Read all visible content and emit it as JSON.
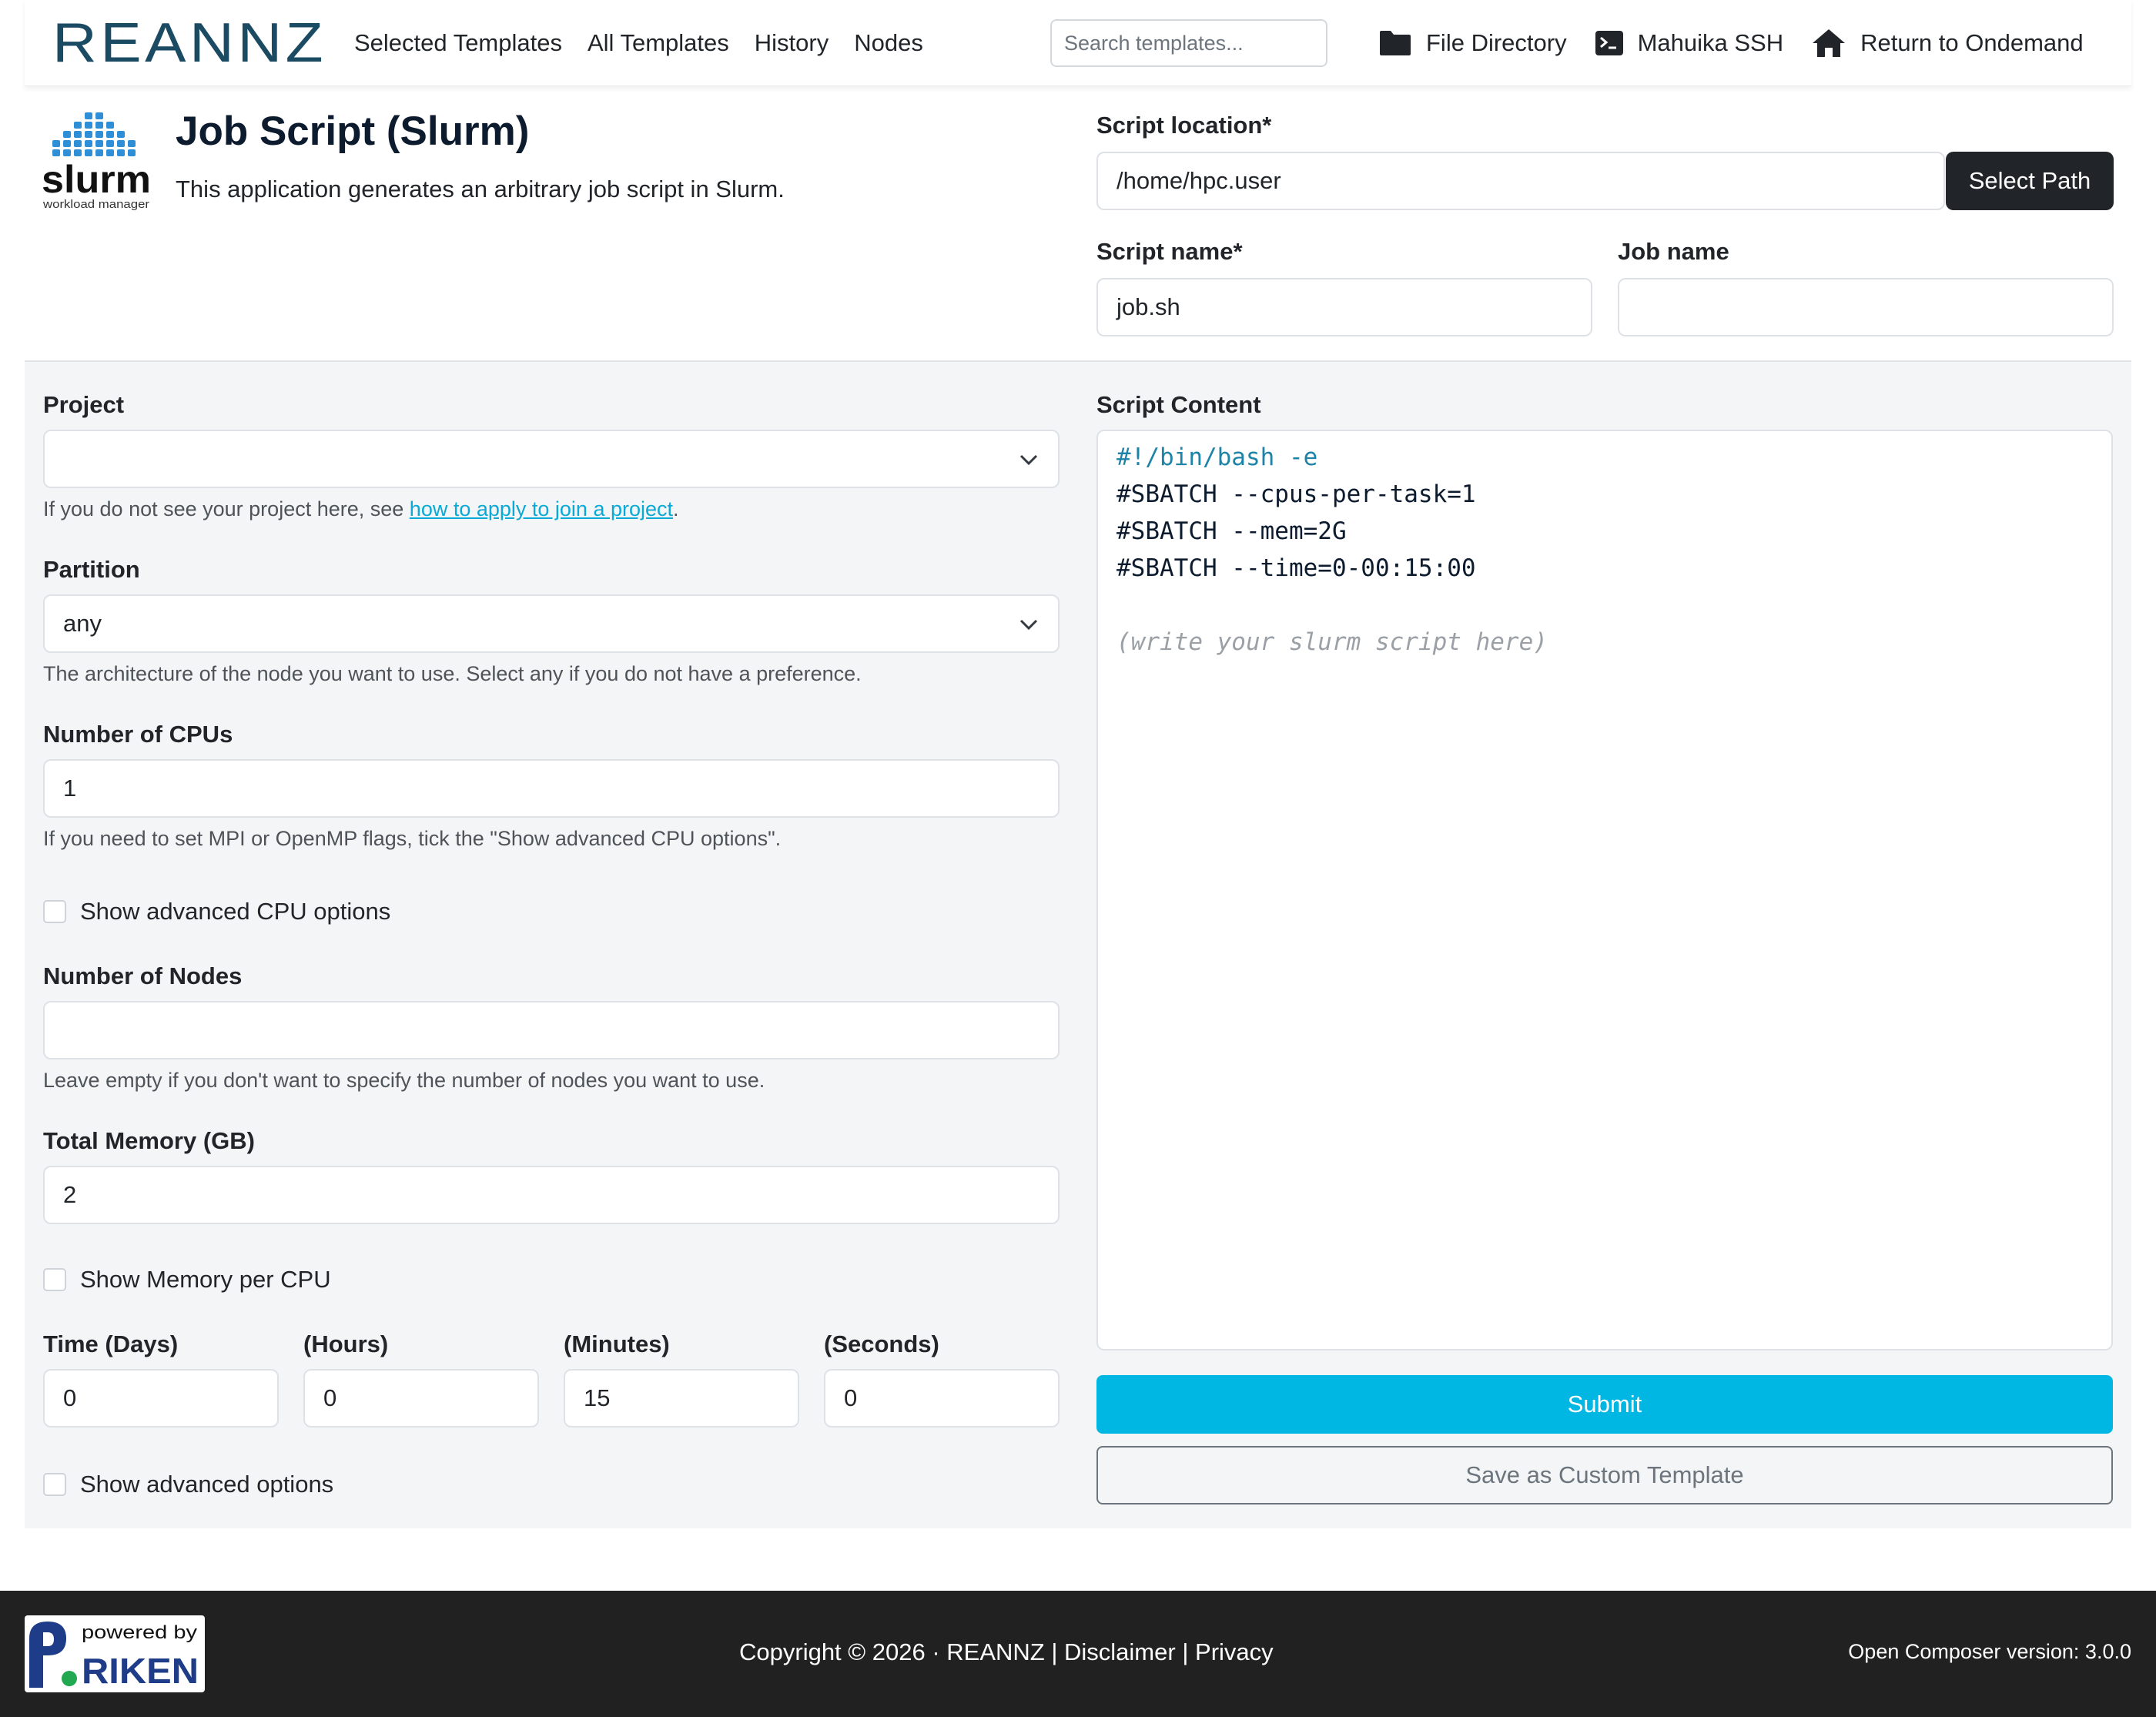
{
  "navbar": {
    "brand": "REANNZ",
    "links": [
      "Selected Templates",
      "All Templates",
      "History",
      "Nodes"
    ],
    "search_placeholder": "Search templates...",
    "actions": [
      "File Directory",
      "Mahuika SSH",
      "Return to Ondemand"
    ]
  },
  "header": {
    "logo_text": "slurm",
    "logo_subtext": "workload manager",
    "title": "Job Script (Slurm)",
    "description": "This application generates an arbitrary job script in Slurm."
  },
  "script_location": {
    "label": "Script location*",
    "value": "/home/hpc.user",
    "button": "Select Path"
  },
  "script_name": {
    "label": "Script name*",
    "value": "job.sh"
  },
  "job_name": {
    "label": "Job name",
    "value": ""
  },
  "form": {
    "project": {
      "label": "Project",
      "value": "",
      "help_prefix": "If you do not see your project here, see ",
      "help_link": "how to apply to join a project",
      "help_suffix": "."
    },
    "partition": {
      "label": "Partition",
      "value": "any",
      "help": "The architecture of the node you want to use. Select any if you do not have a preference."
    },
    "cpus": {
      "label": "Number of CPUs",
      "value": "1",
      "help": "If you need to set MPI or OpenMP flags, tick the \"Show advanced CPU options\"."
    },
    "advanced_cpu": "Show advanced CPU options",
    "nodes": {
      "label": "Number of Nodes",
      "value": "",
      "help": "Leave empty if you don't want to specify the number of nodes you want to use."
    },
    "memory": {
      "label": "Total Memory (GB)",
      "value": "2"
    },
    "memory_per_cpu": "Show Memory per CPU",
    "time": {
      "days_label": "Time (Days)",
      "hours_label": "(Hours)",
      "minutes_label": "(Minutes)",
      "seconds_label": "(Seconds)",
      "days": "0",
      "hours": "0",
      "minutes": "15",
      "seconds": "0"
    },
    "advanced_options": "Show advanced options"
  },
  "script": {
    "label": "Script Content",
    "lines": [
      "#!/bin/bash -e",
      "#SBATCH --cpus-per-task=1",
      "#SBATCH --mem=2G",
      "#SBATCH --time=0-00:15:00"
    ],
    "placeholder": "(write your slurm script here)"
  },
  "buttons": {
    "submit": "Submit",
    "save_template": "Save as Custom Template"
  },
  "footer": {
    "powered_by": "powered by",
    "riken": "RIKEN",
    "copyright": "Copyright © 2026 · REANNZ",
    "disclaimer": "Disclaimer",
    "privacy": "Privacy",
    "separator": "|",
    "version": "Open Composer version: 3.0.0"
  },
  "colors": {
    "accent": "#00b6e3",
    "dark": "#212529",
    "footer_bg": "#212121",
    "panel_bg": "#f4f5f6"
  }
}
